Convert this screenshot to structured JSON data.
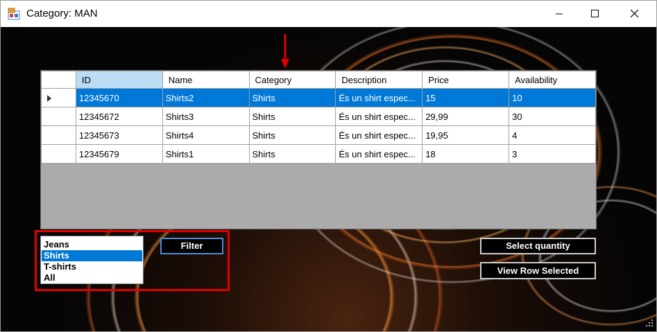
{
  "window": {
    "title": "Category: MAN"
  },
  "grid": {
    "columns": [
      "ID",
      "Name",
      "Category",
      "Description",
      "Price",
      "Availability"
    ],
    "rows": [
      [
        "12345670",
        "Shirts2",
        "Shirts",
        "És un shirt espec...",
        "15",
        "10"
      ],
      [
        "12345672",
        "Shirts3",
        "Shirts",
        "És un shirt espec...",
        "29,99",
        "30"
      ],
      [
        "12345673",
        "Shirts4",
        "Shirts",
        "És un shirt espec...",
        "19,95",
        "4"
      ],
      [
        "12345679",
        "Shirts1",
        "Shirts",
        "És un shirt espec...",
        "18",
        "3"
      ]
    ],
    "selected_row": 0
  },
  "category_list": {
    "items": [
      "Jeans",
      "Shirts",
      "T-shirts",
      "All"
    ],
    "selected": "Shirts"
  },
  "buttons": {
    "filter": "Filter",
    "select_quantity": "Select quantity",
    "view_row_selected": "View Row Selected"
  },
  "colors": {
    "selection": "#0078d7",
    "annotation": "#e00000",
    "sorted_header": "#bcdcf4"
  }
}
